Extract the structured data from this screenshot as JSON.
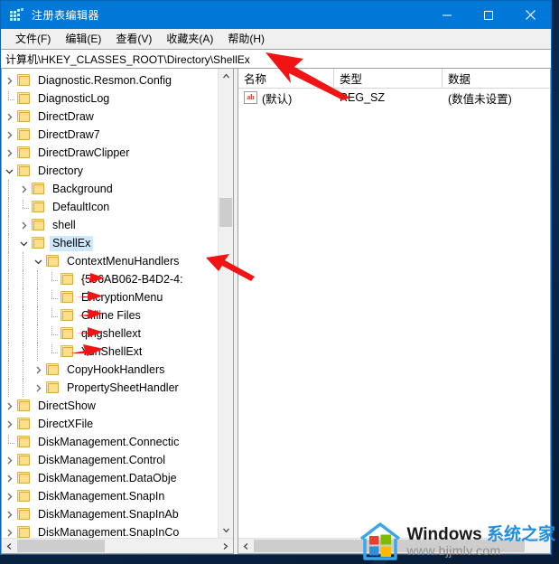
{
  "window": {
    "title": "注册表编辑器",
    "app_icon": "registry-editor-icon",
    "controls": {
      "minimize": "最小化",
      "maximize": "最大化",
      "close": "关闭"
    },
    "titlebar_color": "#0078d7"
  },
  "menubar": {
    "items": [
      {
        "label": "文件(F)"
      },
      {
        "label": "编辑(E)"
      },
      {
        "label": "查看(V)"
      },
      {
        "label": "收藏夹(A)"
      },
      {
        "label": "帮助(H)"
      }
    ]
  },
  "address": {
    "path": "计算机\\HKEY_CLASSES_ROOT\\Directory\\ShellEx"
  },
  "tree": {
    "selected": "ShellEx",
    "selection_color": "#cde8ff",
    "items": [
      {
        "label": "Diagnostic.Resmon.Config",
        "depth": 1,
        "state": "collapsed"
      },
      {
        "label": "DiagnosticLog",
        "depth": 1,
        "state": "leaf"
      },
      {
        "label": "DirectDraw",
        "depth": 1,
        "state": "collapsed"
      },
      {
        "label": "DirectDraw7",
        "depth": 1,
        "state": "collapsed"
      },
      {
        "label": "DirectDrawClipper",
        "depth": 1,
        "state": "collapsed"
      },
      {
        "label": "Directory",
        "depth": 1,
        "state": "expanded"
      },
      {
        "label": "Background",
        "depth": 2,
        "state": "collapsed"
      },
      {
        "label": "DefaultIcon",
        "depth": 2,
        "state": "leaf"
      },
      {
        "label": "shell",
        "depth": 2,
        "state": "collapsed"
      },
      {
        "label": "ShellEx",
        "depth": 2,
        "state": "expanded",
        "selected": true
      },
      {
        "label": "ContextMenuHandlers",
        "depth": 3,
        "state": "expanded"
      },
      {
        "label": "{596AB062-B4D2-4:",
        "depth": 4,
        "state": "leaf"
      },
      {
        "label": "EncryptionMenu",
        "depth": 4,
        "state": "leaf"
      },
      {
        "label": "Offline Files",
        "depth": 4,
        "state": "leaf"
      },
      {
        "label": "qingshellext",
        "depth": 4,
        "state": "leaf"
      },
      {
        "label": "YunShellExt",
        "depth": 4,
        "state": "leaf"
      },
      {
        "label": "CopyHookHandlers",
        "depth": 3,
        "state": "collapsed"
      },
      {
        "label": "PropertySheetHandler",
        "depth": 3,
        "state": "collapsed"
      },
      {
        "label": "DirectShow",
        "depth": 1,
        "state": "collapsed"
      },
      {
        "label": "DirectXFile",
        "depth": 1,
        "state": "collapsed"
      },
      {
        "label": "DiskManagement.Connectic",
        "depth": 1,
        "state": "leaf"
      },
      {
        "label": "DiskManagement.Control",
        "depth": 1,
        "state": "collapsed"
      },
      {
        "label": "DiskManagement.DataObje",
        "depth": 1,
        "state": "collapsed"
      },
      {
        "label": "DiskManagement.SnapIn",
        "depth": 1,
        "state": "collapsed"
      },
      {
        "label": "DiskManagement.SnapInAb",
        "depth": 1,
        "state": "collapsed"
      },
      {
        "label": "DiskManagement.SnapInCo",
        "depth": 1,
        "state": "collapsed"
      }
    ]
  },
  "list": {
    "columns": [
      {
        "label": "名称"
      },
      {
        "label": "类型"
      },
      {
        "label": "数据"
      }
    ],
    "rows": [
      {
        "icon": "ab-string-value-icon",
        "name": "(默认)",
        "type": "REG_SZ",
        "data": "(数值未设置)"
      }
    ]
  },
  "annotations": {
    "arrow_color": "#f01414",
    "markers": [
      {
        "name": "address-bar-arrow",
        "points_to": "计算机\\HKEY_CLASSES_ROOT\\Directory\\ShellEx"
      },
      {
        "name": "context-menu-handlers-arrow",
        "points_to": "ContextMenuHandlers"
      },
      {
        "name": "guid-key-arrow",
        "points_to": "{596AB062-B4D2-4:"
      },
      {
        "name": "encryption-menu-arrow",
        "points_to": "EncryptionMenu"
      },
      {
        "name": "offline-files-arrow",
        "points_to": "Offline Files"
      },
      {
        "name": "qingshellext-arrow",
        "points_to": "qingshellext"
      },
      {
        "name": "yunshellext-arrow",
        "points_to": "YunShellExt"
      }
    ]
  },
  "watermark": {
    "brand_en": "Windows ",
    "brand_cn": "系统之家",
    "url": "www.bjjmlv.com",
    "brand_cn_color": "#1f8fe0"
  }
}
